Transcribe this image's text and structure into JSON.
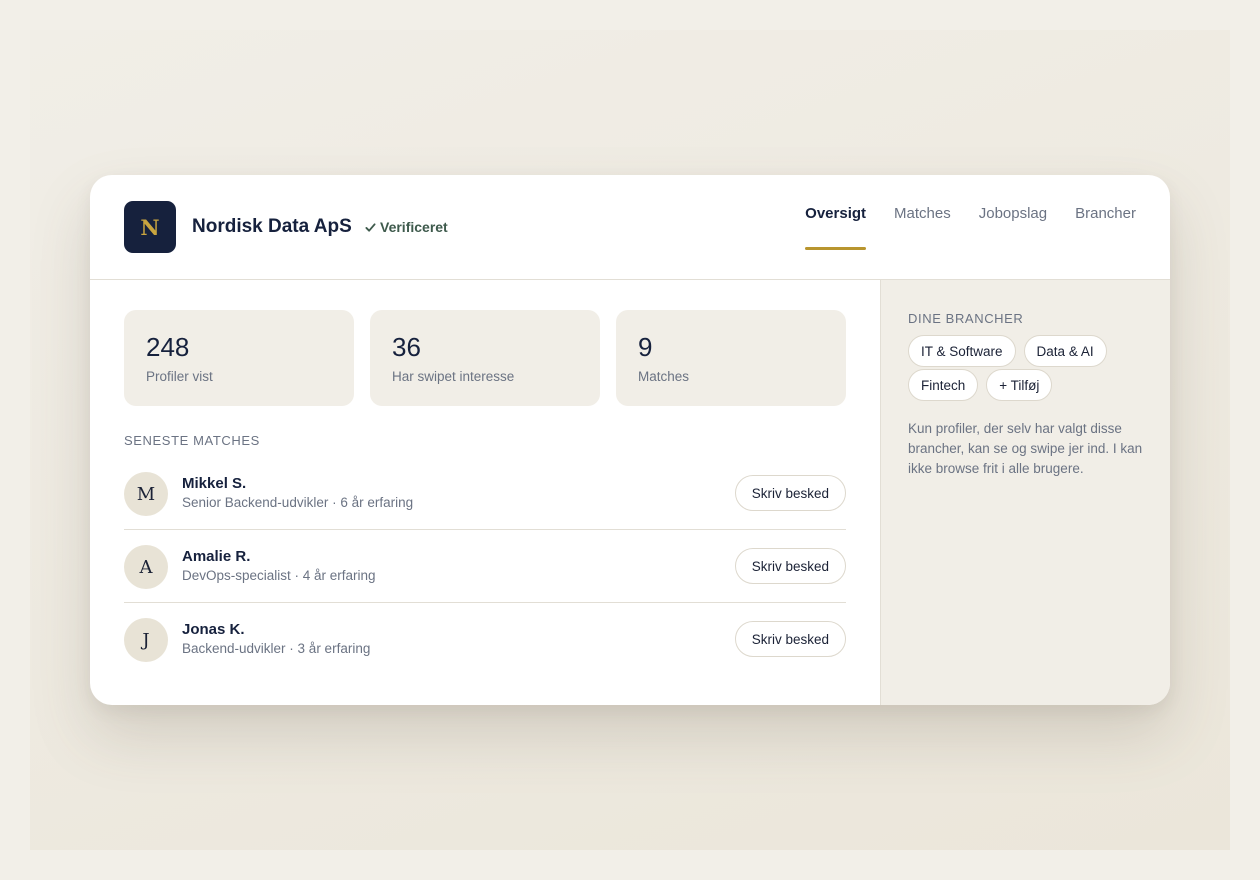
{
  "header": {
    "logo_letter": "N",
    "company_name": "Nordisk Data ApS",
    "verified_label": "Verificeret",
    "tabs": [
      {
        "label": "Oversigt",
        "active": true
      },
      {
        "label": "Matches",
        "active": false
      },
      {
        "label": "Jobopslag",
        "active": false
      },
      {
        "label": "Brancher",
        "active": false
      }
    ]
  },
  "stats": [
    {
      "value": "248",
      "label": "Profiler vist"
    },
    {
      "value": "36",
      "label": "Har swipet interesse"
    },
    {
      "value": "9",
      "label": "Matches"
    }
  ],
  "recent_matches": {
    "title": "SENESTE MATCHES",
    "items": [
      {
        "initial": "M",
        "name": "Mikkel S.",
        "meta": "Senior Backend-udvikler · 6 år erfaring",
        "button_label": "Skriv besked"
      },
      {
        "initial": "A",
        "name": "Amalie R.",
        "meta": "DevOps-specialist · 4 år erfaring",
        "button_label": "Skriv besked"
      },
      {
        "initial": "J",
        "name": "Jonas K.",
        "meta": "Backend-udvikler · 3 år erfaring",
        "button_label": "Skriv besked"
      }
    ]
  },
  "sidebar": {
    "title": "DINE BRANCHER",
    "chips": [
      "IT & Software",
      "Data & AI",
      "Fintech"
    ],
    "add_chip_label": "+ Tilføj",
    "note": "Kun profiler, der selv har valgt disse brancher, kan se og swipe jer ind. I kan ikke browse frit i alle brugere."
  },
  "colors": {
    "page_bg": "#f2efe8",
    "navy": "#16213d",
    "gold_accent": "#b8952e",
    "verified_green": "#3e5a4c",
    "muted_text": "#6b7383",
    "panel_bg": "#f1eee7"
  }
}
